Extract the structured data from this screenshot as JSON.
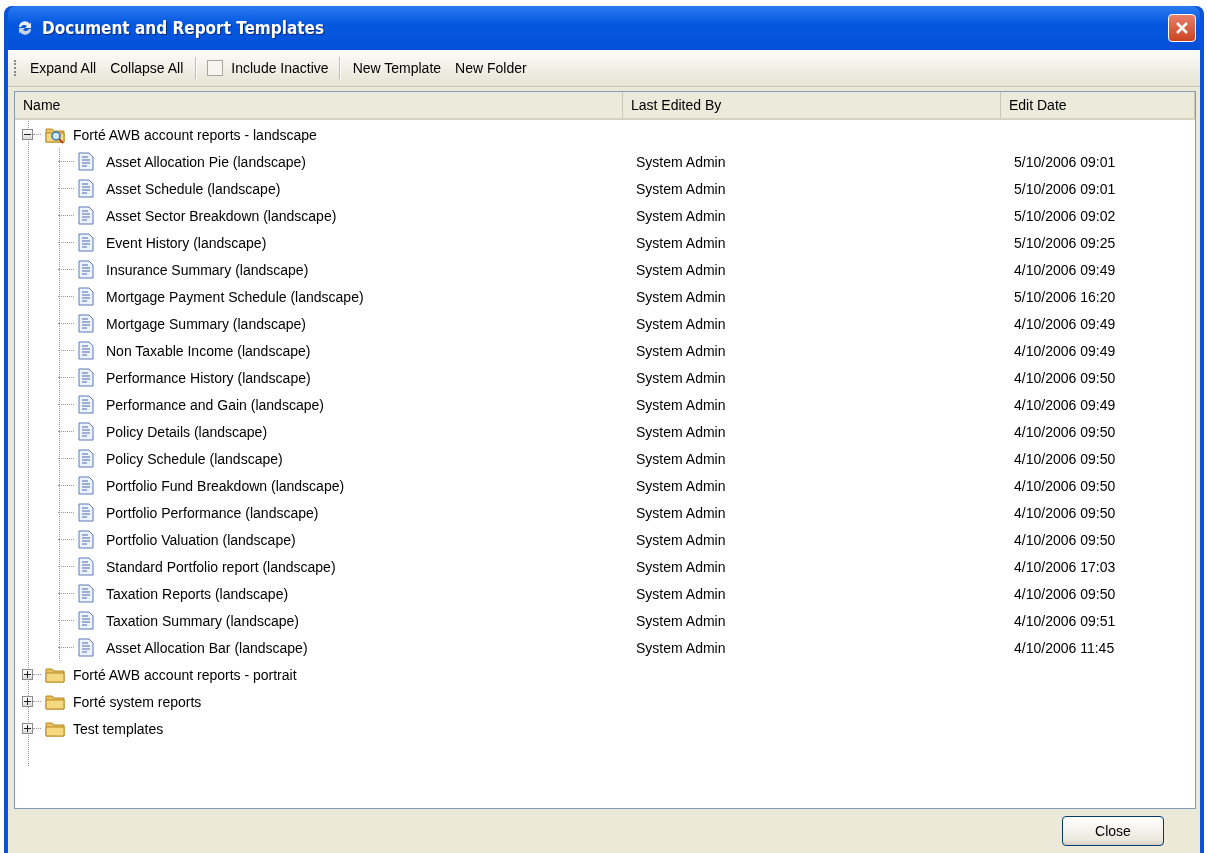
{
  "window": {
    "title": "Document and Report Templates"
  },
  "toolbar": {
    "items": [
      {
        "kind": "button",
        "label": "Expand All"
      },
      {
        "kind": "button",
        "label": "Collapse All"
      },
      {
        "kind": "separator"
      },
      {
        "kind": "checkbox",
        "label": "Include Inactive",
        "checked": false
      },
      {
        "kind": "separator"
      },
      {
        "kind": "button",
        "label": "New Template"
      },
      {
        "kind": "button",
        "label": "New Folder"
      }
    ]
  },
  "table": {
    "columns": [
      "Name",
      "Last Edited By",
      "Edit Date"
    ],
    "rows": [
      {
        "name": "Forté AWB account reports - landscape",
        "expanded": true,
        "children": [
          {
            "name": "Asset Allocation Pie (landscape)",
            "editor": "System Admin",
            "date": "5/10/2006 09:01"
          },
          {
            "name": "Asset Schedule (landscape)",
            "editor": "System Admin",
            "date": "5/10/2006 09:01"
          },
          {
            "name": "Asset Sector Breakdown (landscape)",
            "editor": "System Admin",
            "date": "5/10/2006 09:02"
          },
          {
            "name": "Event History (landscape)",
            "editor": "System Admin",
            "date": "5/10/2006 09:25"
          },
          {
            "name": "Insurance Summary (landscape)",
            "editor": "System Admin",
            "date": "4/10/2006 09:49"
          },
          {
            "name": "Mortgage Payment Schedule (landscape)",
            "editor": "System Admin",
            "date": "5/10/2006 16:20"
          },
          {
            "name": "Mortgage Summary (landscape)",
            "editor": "System Admin",
            "date": "4/10/2006 09:49"
          },
          {
            "name": "Non Taxable Income (landscape)",
            "editor": "System Admin",
            "date": "4/10/2006 09:49"
          },
          {
            "name": "Performance History (landscape)",
            "editor": "System Admin",
            "date": "4/10/2006 09:50"
          },
          {
            "name": "Performance and Gain (landscape)",
            "editor": "System Admin",
            "date": "4/10/2006 09:49"
          },
          {
            "name": "Policy Details (landscape)",
            "editor": "System Admin",
            "date": "4/10/2006 09:50"
          },
          {
            "name": "Policy Schedule (landscape)",
            "editor": "System Admin",
            "date": "4/10/2006 09:50"
          },
          {
            "name": "Portfolio Fund Breakdown (landscape)",
            "editor": "System Admin",
            "date": "4/10/2006 09:50"
          },
          {
            "name": "Portfolio Performance (landscape)",
            "editor": "System Admin",
            "date": "4/10/2006 09:50"
          },
          {
            "name": "Portfolio Valuation (landscape)",
            "editor": "System Admin",
            "date": "4/10/2006 09:50"
          },
          {
            "name": "Standard Portfolio report (landscape)",
            "editor": "System Admin",
            "date": "4/10/2006 17:03"
          },
          {
            "name": "Taxation Reports (landscape)",
            "editor": "System Admin",
            "date": "4/10/2006 09:50"
          },
          {
            "name": "Taxation Summary (landscape)",
            "editor": "System Admin",
            "date": "4/10/2006 09:51"
          },
          {
            "name": "Asset Allocation Bar (landscape)",
            "editor": "System Admin",
            "date": "4/10/2006 11:45"
          }
        ]
      },
      {
        "name": "Forté AWB account reports - portrait",
        "expanded": false
      },
      {
        "name": "Forté system reports",
        "expanded": false
      },
      {
        "name": "Test templates",
        "expanded": false
      }
    ]
  },
  "buttons": [
    "Close"
  ]
}
